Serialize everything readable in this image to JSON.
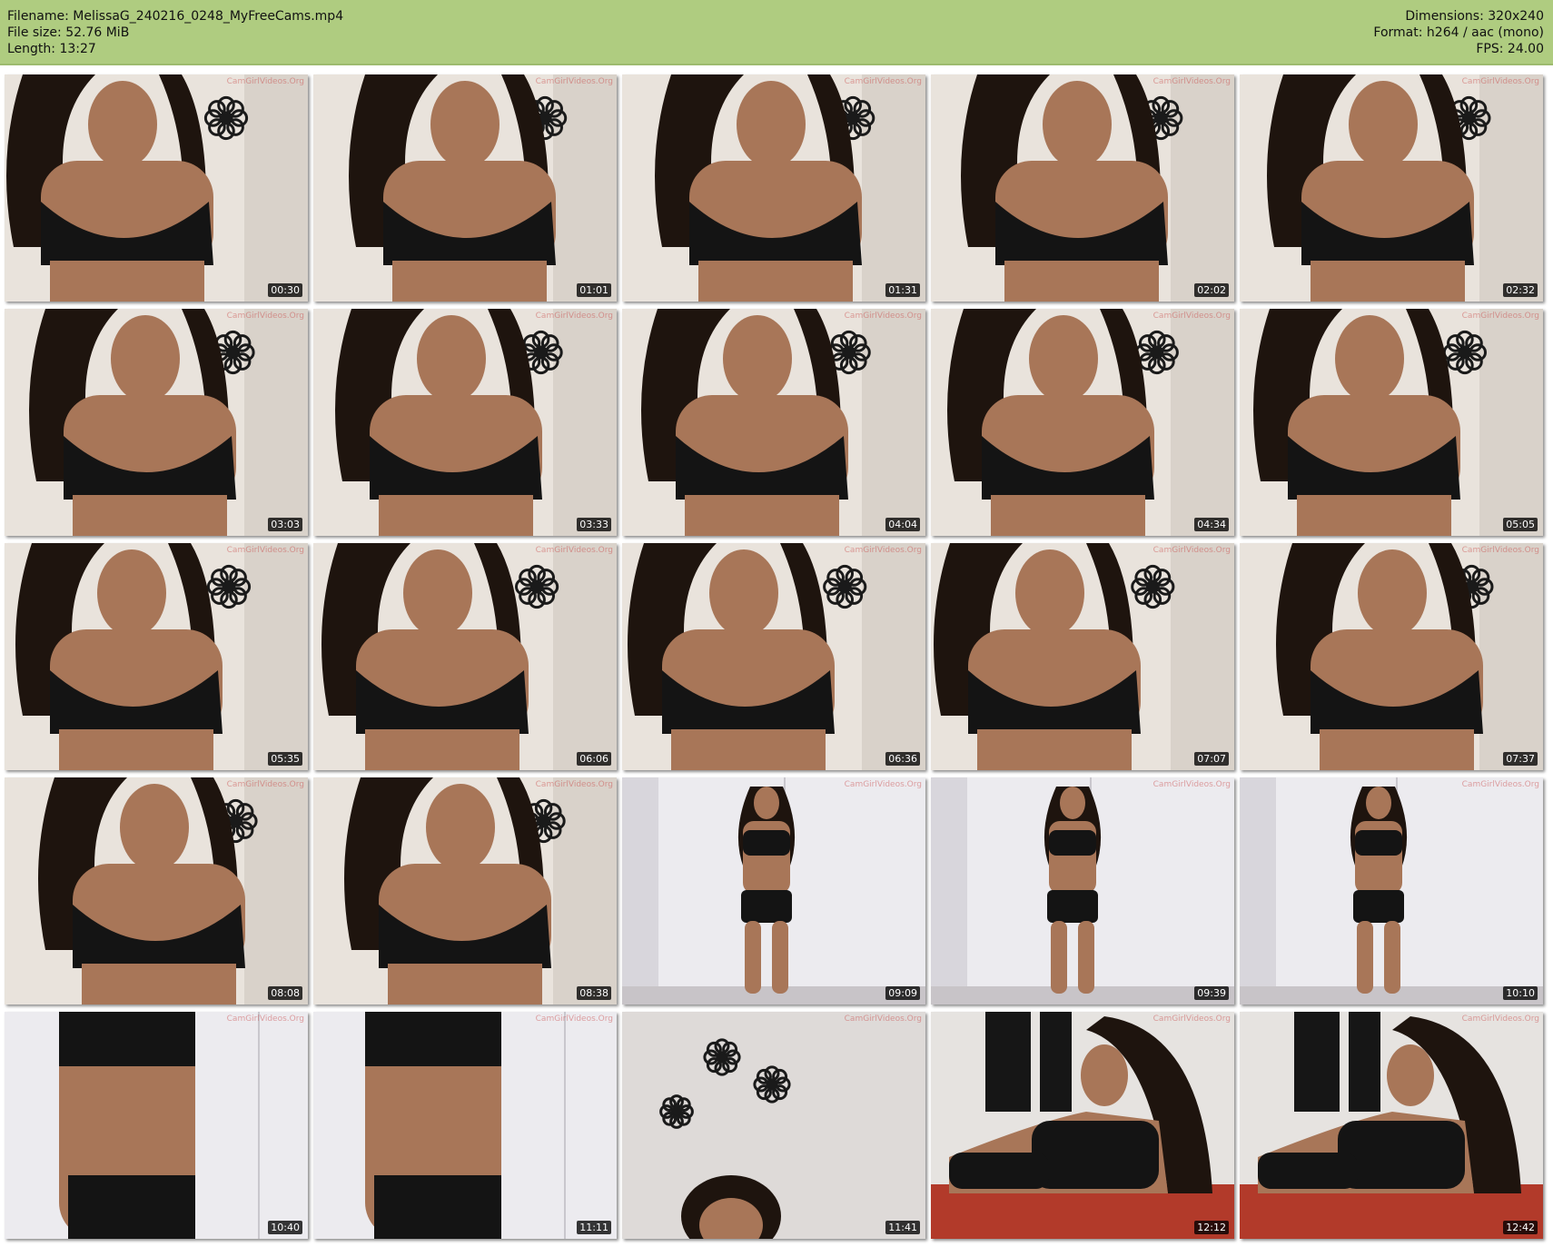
{
  "header": {
    "filename": "Filename: MelissaG_240216_0248_MyFreeCams.mp4",
    "filesize": "File size: 52.76 MiB",
    "length": "Length: 13:27",
    "dimensions": "Dimensions: 320x240",
    "format": "Format: h264 / aac (mono)",
    "fps": "FPS: 24.00"
  },
  "watermark": "CamGirlVideos.Org",
  "thumbnails": [
    {
      "time": "00:30",
      "scene": "wall"
    },
    {
      "time": "01:01",
      "scene": "wall"
    },
    {
      "time": "01:31",
      "scene": "wall"
    },
    {
      "time": "02:02",
      "scene": "wall"
    },
    {
      "time": "02:32",
      "scene": "wall"
    },
    {
      "time": "03:03",
      "scene": "wall"
    },
    {
      "time": "03:33",
      "scene": "wall"
    },
    {
      "time": "04:04",
      "scene": "wall"
    },
    {
      "time": "04:34",
      "scene": "wall"
    },
    {
      "time": "05:05",
      "scene": "wall"
    },
    {
      "time": "05:35",
      "scene": "wall"
    },
    {
      "time": "06:06",
      "scene": "wall"
    },
    {
      "time": "06:36",
      "scene": "wall"
    },
    {
      "time": "07:07",
      "scene": "wall"
    },
    {
      "time": "07:37",
      "scene": "wall"
    },
    {
      "time": "08:08",
      "scene": "wall"
    },
    {
      "time": "08:38",
      "scene": "wall"
    },
    {
      "time": "09:09",
      "scene": "standing"
    },
    {
      "time": "09:39",
      "scene": "standing"
    },
    {
      "time": "10:10",
      "scene": "standing"
    },
    {
      "time": "10:40",
      "scene": "closeup"
    },
    {
      "time": "11:11",
      "scene": "closeup"
    },
    {
      "time": "11:41",
      "scene": "ceiling"
    },
    {
      "time": "12:12",
      "scene": "bed"
    },
    {
      "time": "12:42",
      "scene": "bed"
    }
  ],
  "colors": {
    "header_bg": "#afcc80",
    "wall": "#e9e3dc",
    "door": "#ecebef",
    "top": "#141414",
    "skin": "#a87658",
    "hair": "#1e140e",
    "bed": "#b23a2a"
  }
}
